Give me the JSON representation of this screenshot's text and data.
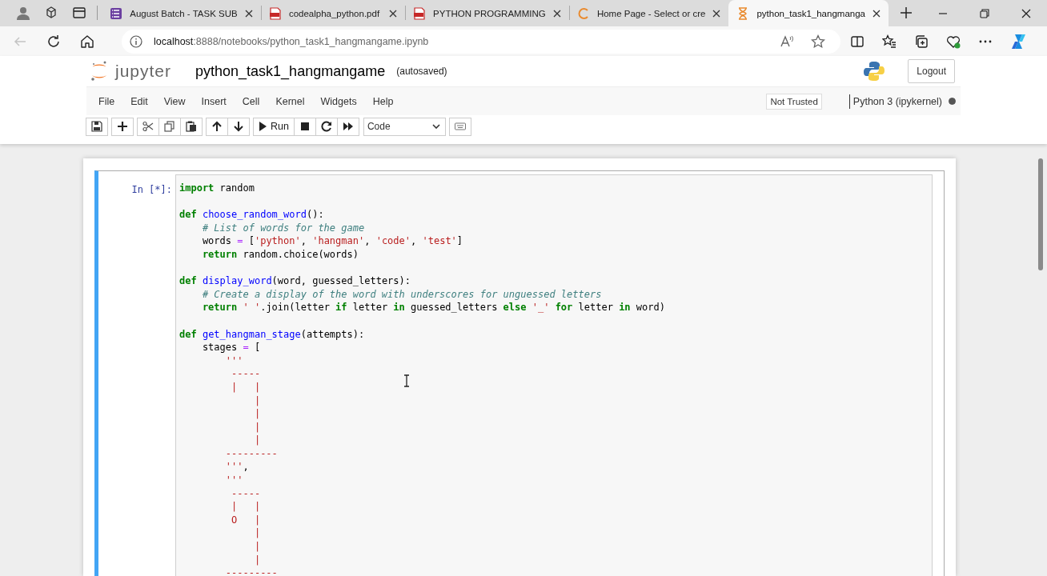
{
  "browser": {
    "tabs": [
      {
        "title": "August Batch - TASK SUB",
        "kind": "form",
        "selected": false
      },
      {
        "title": "codealpha_python.pdf",
        "kind": "pdf",
        "selected": false
      },
      {
        "title": "PYTHON PROGRAMMING",
        "kind": "pdf",
        "selected": false
      },
      {
        "title": "Home Page - Select or cre",
        "kind": "loading",
        "selected": false
      },
      {
        "title": "python_task1_hangmanga",
        "kind": "busy",
        "selected": true
      }
    ],
    "address": {
      "url": "**localhost**:8888/notebooks/python_task1_hangmangame.ipynb"
    }
  },
  "notebook": {
    "logo_text": "jupyter",
    "title": "python_task1_hangmangame",
    "save_status": "(autosaved)",
    "logout": "Logout",
    "menu": [
      "File",
      "Edit",
      "View",
      "Insert",
      "Cell",
      "Kernel",
      "Widgets",
      "Help"
    ],
    "trust": "Not Trusted",
    "kernel": {
      "name": "Python 3 (ipykernel)",
      "busy": true
    },
    "toolbar": {
      "run": "Run",
      "cell_type": "Code"
    }
  },
  "cell": {
    "prompt": "In [*]:",
    "selected": true,
    "lines": [
      {
        "kind": "code",
        "tokens": [
          {
            "kind": "keyword",
            "text": "import"
          },
          {
            "kind": "plain",
            "text": " random"
          }
        ]
      },
      {
        "kind": "blank"
      },
      {
        "kind": "code",
        "tokens": [
          {
            "kind": "keyword",
            "text": "def"
          },
          {
            "kind": "function",
            "text": " choose_random_word"
          },
          {
            "kind": "plain",
            "text": "():"
          }
        ]
      },
      {
        "kind": "code",
        "tokens": [
          {
            "kind": "comment",
            "text": "    # List of words for the game"
          }
        ]
      },
      {
        "kind": "code",
        "tokens": [
          {
            "kind": "plain",
            "text": "    words "
          },
          {
            "kind": "operator",
            "text": "="
          },
          {
            "kind": "plain",
            "text": " ["
          },
          {
            "kind": "string",
            "text": "'python'"
          },
          {
            "kind": "plain",
            "text": ", "
          },
          {
            "kind": "string",
            "text": "'hangman'"
          },
          {
            "kind": "plain",
            "text": ", "
          },
          {
            "kind": "string",
            "text": "'code'"
          },
          {
            "kind": "plain",
            "text": ", "
          },
          {
            "kind": "string",
            "text": "'test'"
          },
          {
            "kind": "plain",
            "text": "]"
          }
        ]
      },
      {
        "kind": "code",
        "tokens": [
          {
            "kind": "keyword",
            "text": "    return"
          },
          {
            "kind": "plain",
            "text": " random.choice(words)"
          }
        ]
      },
      {
        "kind": "blank"
      },
      {
        "kind": "code",
        "tokens": [
          {
            "kind": "keyword",
            "text": "def"
          },
          {
            "kind": "function",
            "text": " display_word"
          },
          {
            "kind": "plain",
            "text": "(word, guessed_letters):"
          }
        ]
      },
      {
        "kind": "code",
        "tokens": [
          {
            "kind": "comment",
            "text": "    # Create a display of the word with underscores for unguessed letters"
          }
        ]
      },
      {
        "kind": "code",
        "tokens": [
          {
            "kind": "keyword",
            "text": "    return"
          },
          {
            "kind": "string",
            "text": " ' '"
          },
          {
            "kind": "plain",
            "text": ".join(letter "
          },
          {
            "kind": "keyword",
            "text": "if"
          },
          {
            "kind": "plain",
            "text": " letter "
          },
          {
            "kind": "keyword",
            "text": "in"
          },
          {
            "kind": "plain",
            "text": " guessed_letters "
          },
          {
            "kind": "keyword",
            "text": "else"
          },
          {
            "kind": "string",
            "text": " '_'"
          },
          {
            "kind": "keyword",
            "text": " for"
          },
          {
            "kind": "plain",
            "text": " letter "
          },
          {
            "kind": "keyword",
            "text": "in"
          },
          {
            "kind": "plain",
            "text": " word)"
          }
        ]
      },
      {
        "kind": "blank"
      },
      {
        "kind": "code",
        "tokens": [
          {
            "kind": "keyword",
            "text": "def"
          },
          {
            "kind": "function",
            "text": " get_hangman_stage"
          },
          {
            "kind": "plain",
            "text": "(attempts):"
          }
        ]
      },
      {
        "kind": "code",
        "tokens": [
          {
            "kind": "plain",
            "text": "    stages "
          },
          {
            "kind": "operator",
            "text": "="
          },
          {
            "kind": "plain",
            "text": " ["
          }
        ]
      },
      {
        "kind": "code",
        "tokens": [
          {
            "kind": "string",
            "text": "        '''"
          }
        ]
      },
      {
        "kind": "code",
        "tokens": [
          {
            "kind": "string",
            "text": "         -----"
          }
        ]
      },
      {
        "kind": "code",
        "tokens": [
          {
            "kind": "string",
            "text": "         |   |"
          }
        ]
      },
      {
        "kind": "code",
        "tokens": [
          {
            "kind": "string",
            "text": "             |"
          }
        ]
      },
      {
        "kind": "code",
        "tokens": [
          {
            "kind": "string",
            "text": "             |"
          }
        ]
      },
      {
        "kind": "code",
        "tokens": [
          {
            "kind": "string",
            "text": "             |"
          }
        ]
      },
      {
        "kind": "code",
        "tokens": [
          {
            "kind": "string",
            "text": "             |"
          }
        ]
      },
      {
        "kind": "code",
        "tokens": [
          {
            "kind": "string",
            "text": "        ---------"
          }
        ]
      },
      {
        "kind": "code",
        "tokens": [
          {
            "kind": "string",
            "text": "        '''"
          },
          {
            "kind": "plain",
            "text": ","
          }
        ]
      },
      {
        "kind": "code",
        "tokens": [
          {
            "kind": "string",
            "text": "        '''"
          }
        ]
      },
      {
        "kind": "code",
        "tokens": [
          {
            "kind": "string",
            "text": "         -----"
          }
        ]
      },
      {
        "kind": "code",
        "tokens": [
          {
            "kind": "string",
            "text": "         |   |"
          }
        ]
      },
      {
        "kind": "code",
        "tokens": [
          {
            "kind": "string",
            "text": "         O   |"
          }
        ]
      },
      {
        "kind": "code",
        "tokens": [
          {
            "kind": "string",
            "text": "             |"
          }
        ]
      },
      {
        "kind": "code",
        "tokens": [
          {
            "kind": "string",
            "text": "             |"
          }
        ]
      },
      {
        "kind": "code",
        "tokens": [
          {
            "kind": "string",
            "text": "             |"
          }
        ]
      },
      {
        "kind": "code",
        "tokens": [
          {
            "kind": "string",
            "text": "        ---------"
          }
        ]
      }
    ]
  }
}
